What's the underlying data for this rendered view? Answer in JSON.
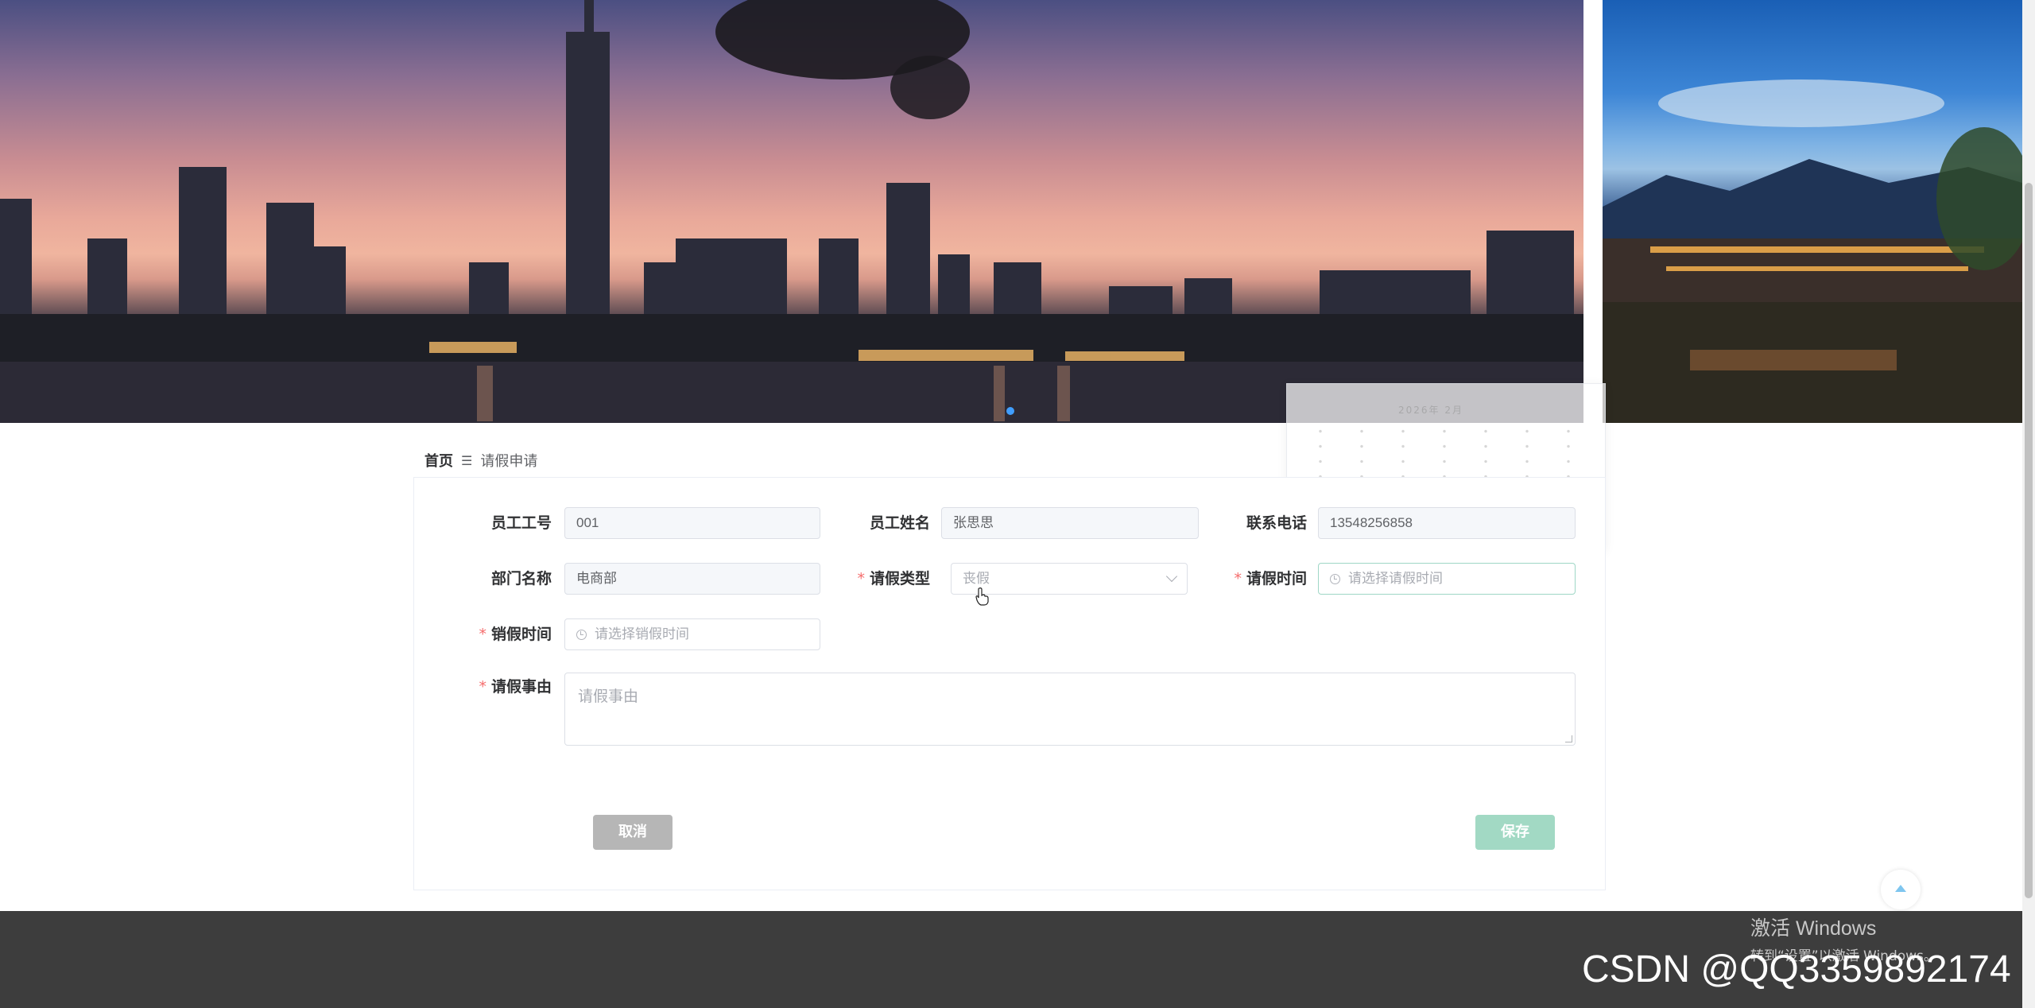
{
  "breadcrumb": {
    "home": "首页",
    "separator": "☰",
    "current": "请假申请"
  },
  "form": {
    "employee_id_label": "员工工号",
    "employee_id_value": "001",
    "employee_name_label": "员工姓名",
    "employee_name_value": "张思思",
    "phone_label": "联系电话",
    "phone_value": "13548256858",
    "department_label": "部门名称",
    "department_value": "电商部",
    "leave_type_label": "请假类型",
    "leave_type_value": "丧假",
    "leave_time_label": "请假时间",
    "leave_time_placeholder": "请选择请假时间",
    "cancel_time_label": "销假时间",
    "cancel_time_placeholder": "请选择销假时间",
    "reason_label": "请假事由",
    "reason_placeholder": "请假事由",
    "required_mark": "*"
  },
  "actions": {
    "cancel_label": "取消",
    "save_label": "保存"
  },
  "ghost_picker": {
    "header_text": "2026年 2月"
  },
  "overlays": {
    "windows_activation_title": "激活 Windows",
    "windows_activation_hint": "转到“设置”以激活 Windows。",
    "watermark": "CSDN @QQ3359892174"
  },
  "colors": {
    "accent": "#409eff",
    "required": "#f56c6c",
    "save_button": "#a2d9c4",
    "cancel_button": "#b6b6b6",
    "footer": "#3d3d3d"
  },
  "icons": [
    "clock-icon",
    "chevron-down-icon",
    "back-to-top-icon",
    "menu-icon"
  ]
}
